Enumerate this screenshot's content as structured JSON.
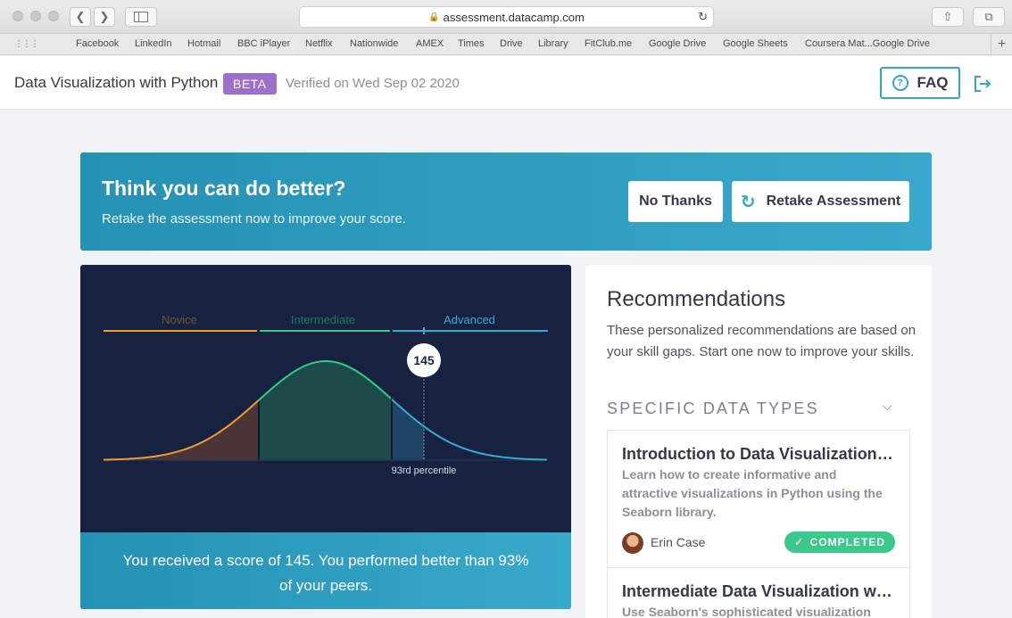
{
  "browser": {
    "url": "assessment.datacamp.com",
    "bookmarks": [
      "Facebook",
      "LinkedIn",
      "Hotmail",
      "BBC iPlayer",
      "Netflix",
      "Nationwide",
      "AMEX",
      "Times",
      "Drive",
      "Library",
      "FitClub.me",
      "Google Drive",
      "Google Sheets",
      "Coursera Mat...Google Drive"
    ]
  },
  "header": {
    "course_title": "Data Visualization with Python",
    "badge": "BETA",
    "verified": "Verified on Wed Sep 02 2020",
    "faq_label": "FAQ"
  },
  "banner": {
    "title": "Think you can do better?",
    "subtitle": "Retake the assessment now to improve your score.",
    "no_thanks": "No Thanks",
    "retake": "Retake Assessment"
  },
  "chart_data": {
    "type": "area",
    "categories": [
      "Novice",
      "Intermediate",
      "Advanced"
    ],
    "score": 145,
    "percentile_label": "93rd percentile",
    "percentile": 93,
    "colors": {
      "novice": "#f09c34",
      "intermediate": "#2ecf85",
      "advanced": "#3aa9d6",
      "background": "#162240"
    }
  },
  "score_text": "You received a score of 145. You performed better than 93% of your peers.",
  "recommendations": {
    "title": "Recommendations",
    "description": "These personalized recommendations are based on your skill gaps. Start one now to improve your skills.",
    "section": "SPECIFIC DATA TYPES",
    "courses": [
      {
        "name": "Introduction to Data Visualization with Seaborn",
        "description": "Learn how to create informative and attractive visualizations in Python using the Seaborn library.",
        "author": "Erin Case",
        "status": "COMPLETED"
      },
      {
        "name": "Intermediate Data Visualization with Seaborn",
        "description": "Use Seaborn's sophisticated visualization tools to"
      }
    ]
  }
}
